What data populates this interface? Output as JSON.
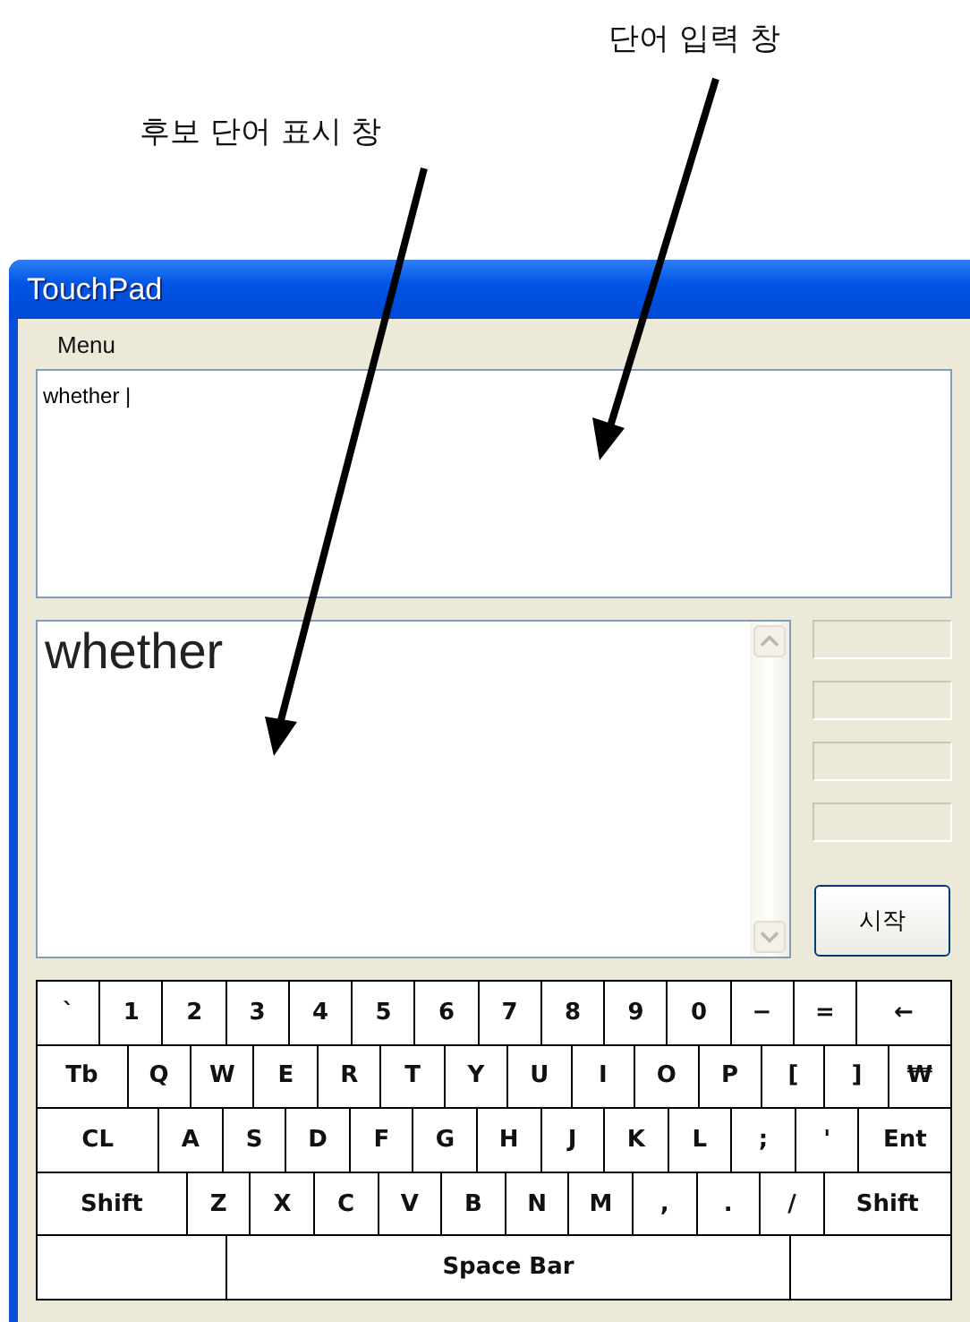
{
  "annotations": [
    {
      "label": "단어 입력 창"
    },
    {
      "label": "후보 단어 표시 창"
    }
  ],
  "window": {
    "title": "TouchPad"
  },
  "menu": [
    "Menu"
  ],
  "input_box": {
    "value": "whether |"
  },
  "candidates": [
    "whether"
  ],
  "start_button": "시작",
  "keyboard": [
    [
      {
        "kind": "key",
        "label": "`"
      },
      {
        "kind": "key",
        "label": "1"
      },
      {
        "kind": "key",
        "label": "2"
      },
      {
        "kind": "key",
        "label": "3"
      },
      {
        "kind": "key",
        "label": "4"
      },
      {
        "kind": "key",
        "label": "5"
      },
      {
        "kind": "key",
        "label": "6"
      },
      {
        "kind": "key",
        "label": "7"
      },
      {
        "kind": "key",
        "label": "8"
      },
      {
        "kind": "key",
        "label": "9"
      },
      {
        "kind": "key",
        "label": "0"
      },
      {
        "kind": "key",
        "label": "−"
      },
      {
        "kind": "key",
        "label": "="
      },
      {
        "kind": "key",
        "label": "←"
      }
    ],
    [
      {
        "kind": "key",
        "label": "Tb"
      },
      {
        "kind": "key",
        "label": "Q"
      },
      {
        "kind": "key",
        "label": "W"
      },
      {
        "kind": "key",
        "label": "E"
      },
      {
        "kind": "key",
        "label": "R"
      },
      {
        "kind": "key",
        "label": "T"
      },
      {
        "kind": "key",
        "label": "Y"
      },
      {
        "kind": "key",
        "label": "U"
      },
      {
        "kind": "key",
        "label": "I"
      },
      {
        "kind": "key",
        "label": "O"
      },
      {
        "kind": "key",
        "label": "P"
      },
      {
        "kind": "key",
        "label": "["
      },
      {
        "kind": "key",
        "label": "]"
      },
      {
        "kind": "key",
        "label": "₩"
      }
    ],
    [
      {
        "kind": "key",
        "label": "CL"
      },
      {
        "kind": "key",
        "label": "A"
      },
      {
        "kind": "key",
        "label": "S"
      },
      {
        "kind": "key",
        "label": "D"
      },
      {
        "kind": "key",
        "label": "F"
      },
      {
        "kind": "key",
        "label": "G"
      },
      {
        "kind": "key",
        "label": "H"
      },
      {
        "kind": "key",
        "label": "J"
      },
      {
        "kind": "key",
        "label": "K"
      },
      {
        "kind": "key",
        "label": "L"
      },
      {
        "kind": "key",
        "label": ";"
      },
      {
        "kind": "key",
        "label": "'"
      },
      {
        "kind": "key",
        "label": "Ent"
      }
    ],
    [
      {
        "kind": "key",
        "label": "Shift"
      },
      {
        "kind": "key",
        "label": "Z"
      },
      {
        "kind": "key",
        "label": "X"
      },
      {
        "kind": "key",
        "label": "C"
      },
      {
        "kind": "key",
        "label": "V"
      },
      {
        "kind": "key",
        "label": "B"
      },
      {
        "kind": "key",
        "label": "N"
      },
      {
        "kind": "key",
        "label": "M"
      },
      {
        "kind": "key",
        "label": ","
      },
      {
        "kind": "key",
        "label": "."
      },
      {
        "kind": "key",
        "label": "/"
      },
      {
        "kind": "key",
        "label": "Shift"
      }
    ],
    [
      {
        "kind": "blank"
      },
      {
        "kind": "key",
        "label": "Space Bar"
      },
      {
        "kind": "blank"
      }
    ]
  ]
}
